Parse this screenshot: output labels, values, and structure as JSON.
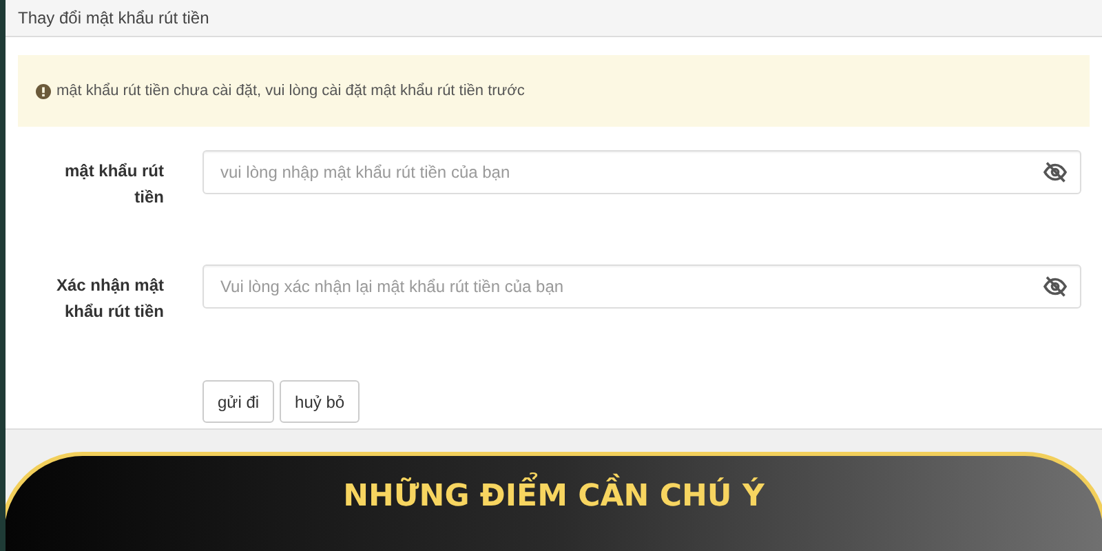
{
  "panel": {
    "title": "Thay đổi mật khẩu rút tiền"
  },
  "alert": {
    "message": "mật khẩu rút tiền chưa cài đặt, vui lòng cài đặt mật khẩu rút tiền trước"
  },
  "fields": [
    {
      "label": "mật khẩu rút tiền",
      "placeholder": "vui lòng nhập mật khẩu rút tiền của bạn"
    },
    {
      "label": "Xác nhận mật khẩu rút tiền",
      "placeholder": "Vui lòng xác nhận lại mật khẩu rút tiền của bạn"
    }
  ],
  "buttons": [
    "gửi đi",
    "huỷ bỏ"
  ],
  "banner": {
    "title": "NHỮNG ĐIỂM CẦN CHÚ Ý"
  }
}
